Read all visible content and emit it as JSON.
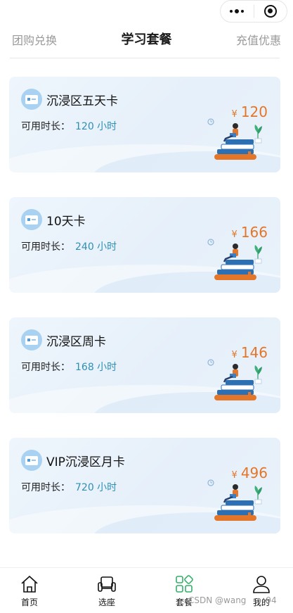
{
  "capsule": {
    "menu_icon": "more-dots-icon",
    "close_icon": "target-circle-icon"
  },
  "header": {
    "left_tab": "团购兑换",
    "title": "学习套餐",
    "right_tab": "充值优惠"
  },
  "packages": [
    {
      "name": "沉浸区五天卡",
      "duration_label": "可用时长：",
      "duration_value": "120 小时",
      "currency": "¥",
      "price": "120"
    },
    {
      "name": "10天卡",
      "duration_label": "可用时长：",
      "duration_value": "240 小时",
      "currency": "¥",
      "price": "166"
    },
    {
      "name": "沉浸区周卡",
      "duration_label": "可用时长：",
      "duration_value": "168 小时",
      "currency": "¥",
      "price": "146"
    },
    {
      "name": "VIP沉浸区月卡",
      "duration_label": "可用时长：",
      "duration_value": "720 小时",
      "currency": "¥",
      "price": "496"
    }
  ],
  "tabbar": {
    "items": [
      {
        "label": "首页",
        "icon": "home-icon"
      },
      {
        "label": "选座",
        "icon": "seat-icon"
      },
      {
        "label": "套餐",
        "icon": "package-icon",
        "active": true
      },
      {
        "label": "我的",
        "icon": "user-icon"
      }
    ]
  },
  "watermark": "CSDN @wang",
  "watermark_suffix": "94",
  "colors": {
    "price": "#e4762a",
    "duration": "#2f8fb3",
    "active_tab": "#35b06a",
    "card_bg": "#eaf3fc"
  }
}
